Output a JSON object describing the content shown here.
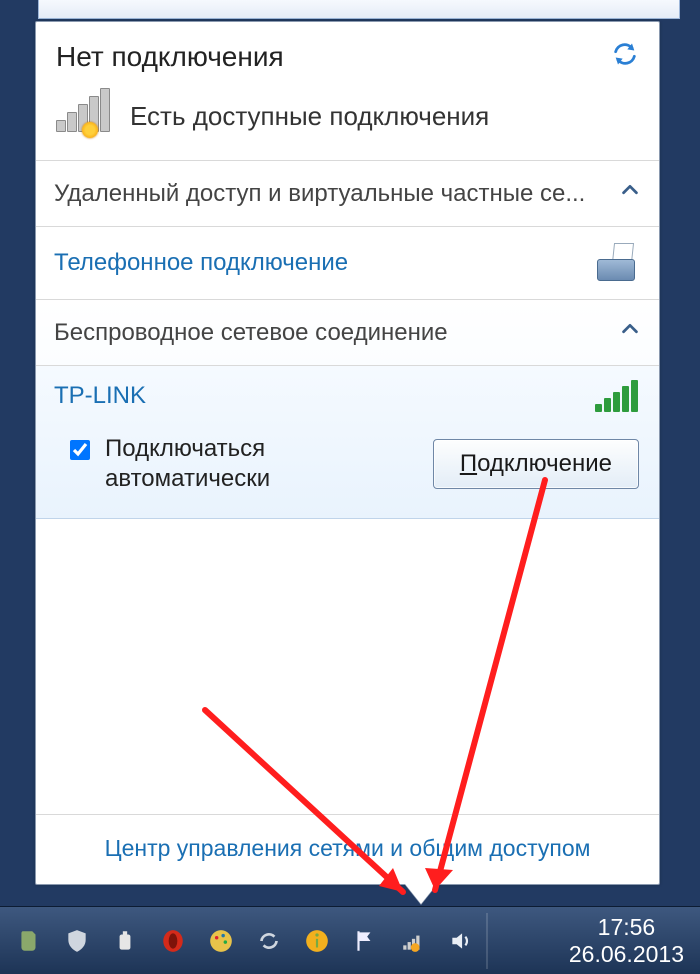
{
  "header": {
    "title": "Нет подключения"
  },
  "available": {
    "text": "Есть доступные подключения"
  },
  "sections": {
    "vpn": "Удаленный доступ и виртуальные частные се...",
    "dial": "Телефонное подключение",
    "wireless": "Беспроводное сетевое соединение"
  },
  "wifi": {
    "name": "TP-LINK",
    "auto_label": "Подключаться автоматически",
    "connect_prefix": "П",
    "connect_rest": "одключение"
  },
  "footer": {
    "link": "Центр управления сетями и общим доступом"
  },
  "clock": {
    "time": "17:56",
    "date": "26.06.2013"
  }
}
